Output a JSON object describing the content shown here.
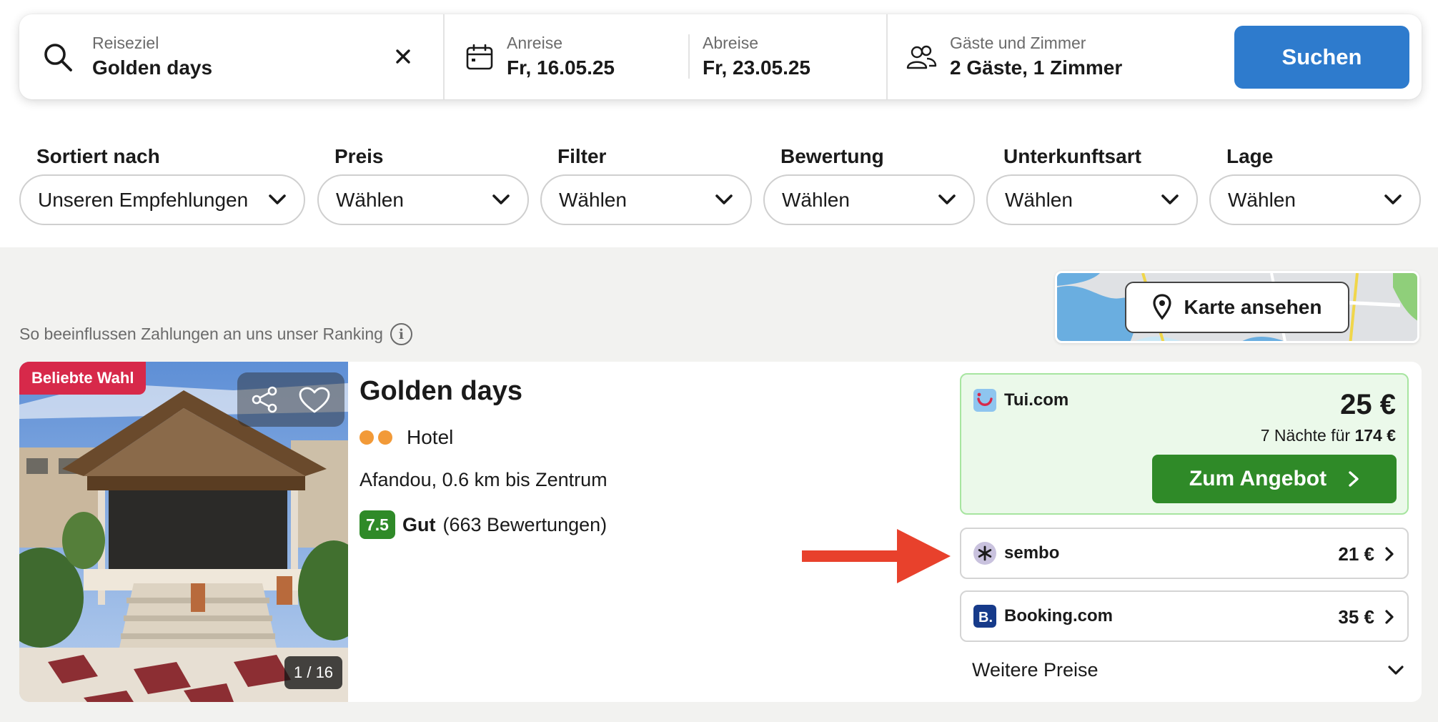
{
  "search": {
    "destination_label": "Reiseziel",
    "destination_value": "Golden days",
    "checkin_label": "Anreise",
    "checkin_value": "Fr, 16.05.25",
    "checkout_label": "Abreise",
    "checkout_value": "Fr, 23.05.25",
    "guests_label": "Gäste und Zimmer",
    "guests_value": "2 Gäste, 1 Zimmer",
    "search_button": "Suchen"
  },
  "filters": [
    {
      "label": "Sortiert nach",
      "value": "Unseren Empfehlungen"
    },
    {
      "label": "Preis",
      "value": "Wählen"
    },
    {
      "label": "Filter",
      "value": "Wählen"
    },
    {
      "label": "Bewertung",
      "value": "Wählen"
    },
    {
      "label": "Unterkunftsart",
      "value": "Wählen"
    },
    {
      "label": "Lage",
      "value": "Wählen"
    }
  ],
  "ranking_note": "So beeinflussen Zahlungen an uns unser Ranking",
  "map_button": "Karte ansehen",
  "hotel": {
    "badge": "Beliebte Wahl",
    "photo_counter": "1 / 16",
    "name": "Golden days",
    "type": "Hotel",
    "stars": 2,
    "location": "Afandou, 0.6 km bis Zentrum",
    "score": "7.5",
    "rating_word": "Gut",
    "review_count": "(663 Bewertungen)"
  },
  "offers": {
    "top": {
      "provider": "Tui.com",
      "price": "25 €",
      "nights_prefix": "7 Nächte für",
      "nights_total": "174 €",
      "cta": "Zum Angebot"
    },
    "rows": [
      {
        "provider": "sembo",
        "price": "21 €"
      },
      {
        "provider": "Booking.com",
        "price": "35 €"
      }
    ],
    "more_prices": "Weitere Preise"
  },
  "colors": {
    "accent_blue": "#2e7bcd",
    "deal_green": "#2f8a28",
    "badge_red": "#d7294a",
    "arrow_red": "#e8412c",
    "star_orange": "#f29a38"
  }
}
